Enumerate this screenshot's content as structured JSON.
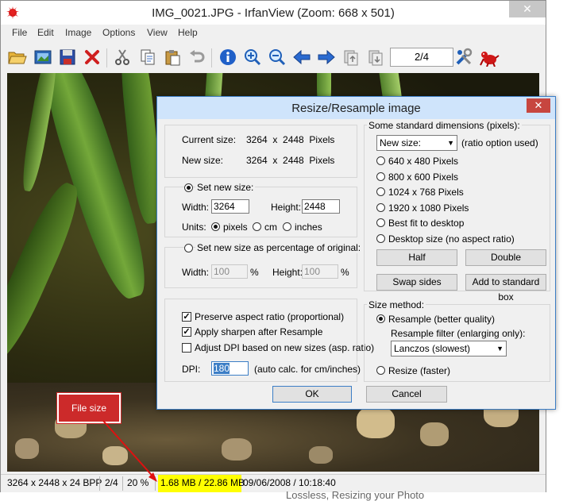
{
  "window": {
    "title": "IMG_0021.JPG - IrfanView (Zoom: 668 x 501)",
    "close_symbol": "✕"
  },
  "menu": [
    "File",
    "Edit",
    "Image",
    "Options",
    "View",
    "Help"
  ],
  "toolbar": {
    "page_indicator": "2/4",
    "icons": [
      "open-folder-icon",
      "slideshow-icon",
      "save-icon",
      "delete-icon",
      "cut-icon",
      "copy-icon",
      "paste-icon",
      "undo-icon",
      "info-icon",
      "zoom-in-icon",
      "zoom-out-icon",
      "previous-icon",
      "next-icon",
      "first-page-icon",
      "last-page-icon",
      "settings-icon",
      "irfanview-logo-icon"
    ]
  },
  "dialog": {
    "title": "Resize/Resample image",
    "close_symbol": "✕",
    "current_size_label": "Current size:",
    "current_size_value": "3264  x  2448  Pixels",
    "new_size_label": "New size:",
    "new_size_value": "3264  x  2448  Pixels",
    "set_new_size_label": "Set new size:",
    "width_label": "Width:",
    "width_value": "3264",
    "height_label": "Height:",
    "height_value": "2448",
    "units_label": "Units:",
    "unit_pixels": "pixels",
    "unit_cm": "cm",
    "unit_inches": "inches",
    "percent_label": "Set new size as percentage of original:",
    "pct_width_label": "Width:",
    "pct_width_value": "100",
    "pct_height_label": "Height:",
    "pct_height_value": "100",
    "pct_sign": "%",
    "preserve_aspect": "Preserve aspect ratio (proportional)",
    "apply_sharpen": "Apply sharpen after Resample",
    "adjust_dpi": "Adjust DPI based on new sizes (asp. ratio)",
    "dpi_label": "DPI:",
    "dpi_value": "180",
    "dpi_note": "(auto calc. for cm/inches)",
    "standard_dims_label": "Some standard dimensions (pixels):",
    "new_size_select": "New size:",
    "ratio_note": "(ratio option used)",
    "dims": [
      "640 x 480 Pixels",
      "800 x 600 Pixels",
      "1024 x 768 Pixels",
      "1920 x 1080 Pixels",
      "Best fit to desktop",
      "Desktop size (no aspect ratio)"
    ],
    "half_button": "Half",
    "double_button": "Double",
    "swap_button": "Swap sides",
    "add_std_button": "Add to standard box",
    "size_method_label": "Size method:",
    "resample_label": "Resample (better quality)",
    "resample_filter_label": "Resample filter (enlarging only):",
    "filter_value": "Lanczos (slowest)",
    "resize_label": "Resize (faster)",
    "ok_button": "OK",
    "cancel_button": "Cancel"
  },
  "callout": {
    "text": "File size"
  },
  "statusbar": {
    "dimensions": "3264 x 2448 x 24 BPP",
    "page": "2/4",
    "zoom": "20 %",
    "filesize": "1.68 MB / 22.86 MB",
    "datetime": "09/06/2008 / 10:18:40"
  },
  "footer_text": "Lossless, Resizing your Photo",
  "colors": {
    "highlight": "#ffff00",
    "callout": "#cc2a2a",
    "accent": "#3c7ec6"
  }
}
